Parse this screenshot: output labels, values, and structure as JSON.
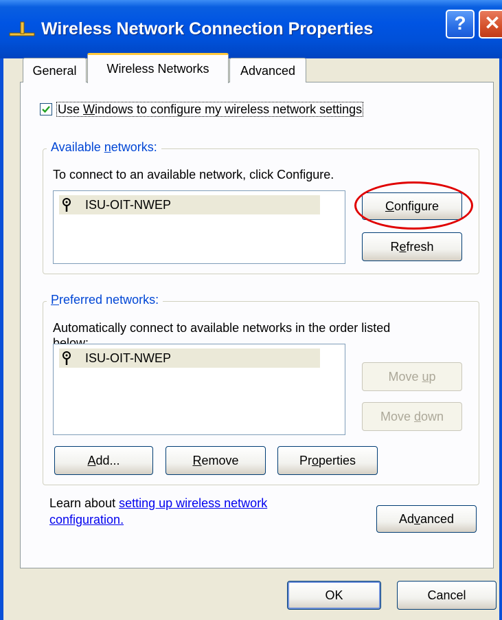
{
  "window": {
    "title": "Wireless Network Connection Properties",
    "help_glyph": "?",
    "close_glyph": "✕",
    "title_icon": "network-connection-icon"
  },
  "tabs": [
    {
      "label": "General"
    },
    {
      "label": "Wireless Networks"
    },
    {
      "label": "Advanced"
    }
  ],
  "checkbox": {
    "checked": true,
    "label_pre": "Use ",
    "label_u": "W",
    "label_post": "indows to configure my wireless network settings"
  },
  "available": {
    "legend_pre": "Available ",
    "legend_u": "n",
    "legend_post": "etworks:",
    "instructions": "To connect to an available network, click Configure.",
    "networks": [
      {
        "name": "ISU-OIT-NWEP",
        "icon": "antenna-icon"
      }
    ],
    "configure_u": "C",
    "configure_rest": "onfigure",
    "refresh_pre": "R",
    "refresh_u": "e",
    "refresh_post": "fresh"
  },
  "preferred": {
    "legend_u": "P",
    "legend_rest": "referred networks:",
    "instructions_line1": "Automatically connect to available networks in the order listed",
    "instructions_line2": "below:",
    "networks": [
      {
        "name": "ISU-OIT-NWEP",
        "icon": "antenna-icon"
      }
    ],
    "move_up_pre": "Move ",
    "move_up_u": "u",
    "move_up_post": "p",
    "move_down_pre": "Move ",
    "move_down_u": "d",
    "move_down_post": "own",
    "add_u": "A",
    "add_rest": "dd...",
    "remove_u": "R",
    "remove_rest": "emove",
    "properties_pre": "Pr",
    "properties_u": "o",
    "properties_post": "perties"
  },
  "learn": {
    "text": "Learn about ",
    "link_line1": "setting up wireless network",
    "link_line2": "configuration."
  },
  "advanced_btn": {
    "pre": "Ad",
    "u": "v",
    "post": "anced"
  },
  "footer": {
    "ok": "OK",
    "cancel": "Cancel"
  },
  "colors": {
    "highlight_circle": "#e00000",
    "title_bar": "#0054e3",
    "legend_text": "#0046d5"
  }
}
